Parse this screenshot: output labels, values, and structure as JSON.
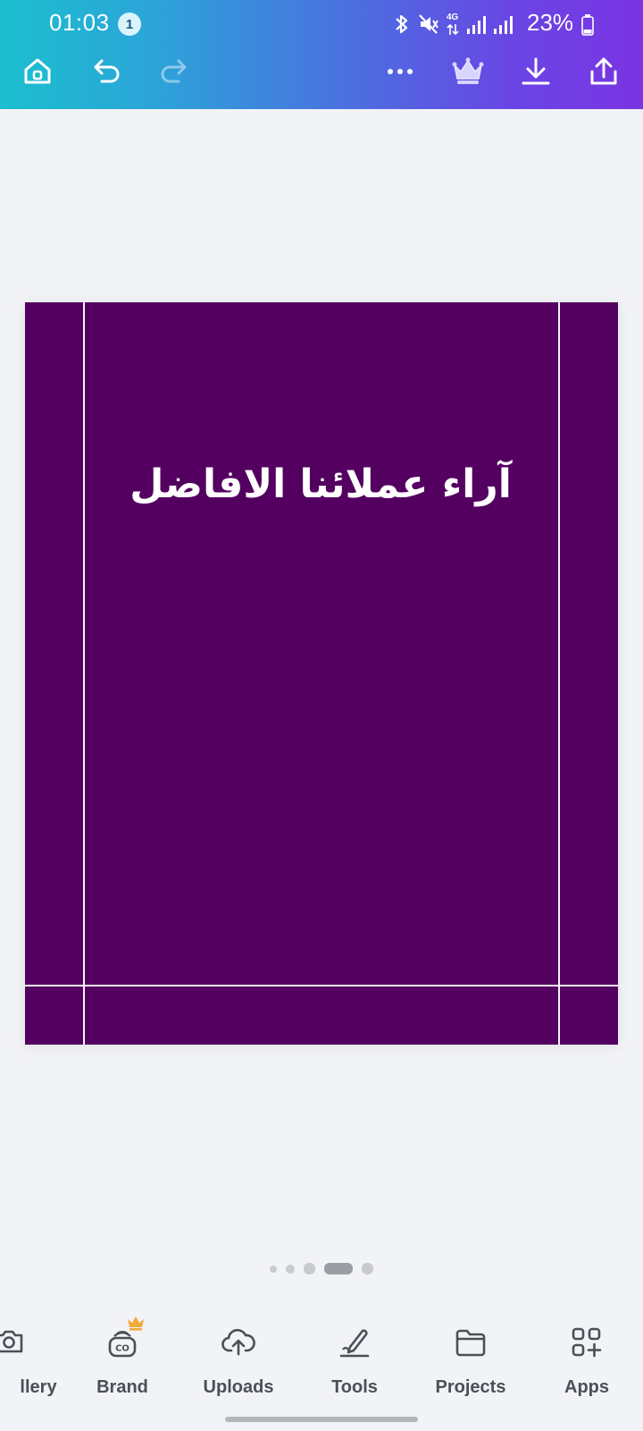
{
  "status_bar": {
    "time": "01:03",
    "notification_count": "1",
    "network": "4G",
    "battery": "23%"
  },
  "toolbar": {
    "home": "home-icon",
    "undo": "undo-icon",
    "redo": "redo-icon",
    "more": "more-icon",
    "premium": "crown-icon",
    "download": "download-icon",
    "share": "share-icon"
  },
  "design": {
    "background_color": "#530060",
    "title": "آراء عملائنا الافاضل"
  },
  "pagination": {
    "pages": 5,
    "current": 4
  },
  "bottom_tools": [
    {
      "label": "llery",
      "icon": "camera-icon"
    },
    {
      "label": "Brand",
      "icon": "brand-icon",
      "badge": "crown-icon"
    },
    {
      "label": "Uploads",
      "icon": "cloud-upload-icon"
    },
    {
      "label": "Tools",
      "icon": "pen-tool-icon"
    },
    {
      "label": "Projects",
      "icon": "folder-icon"
    },
    {
      "label": "Apps",
      "icon": "apps-icon"
    }
  ],
  "colors": {
    "accent_gradient_start": "#1bbfcf",
    "accent_gradient_end": "#7a34e3",
    "crown_badge": "#f2a93b"
  }
}
